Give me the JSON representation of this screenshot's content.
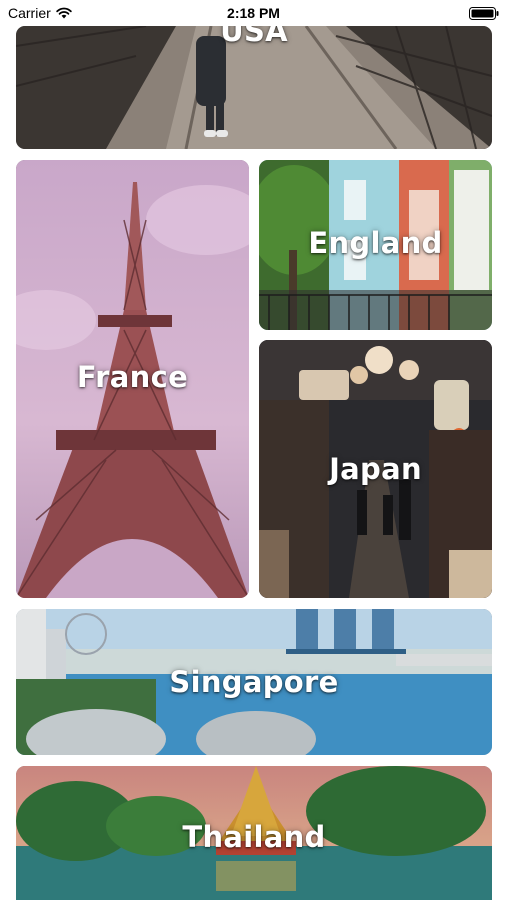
{
  "status_bar": {
    "carrier": "Carrier",
    "time": "2:18 PM"
  },
  "destinations": [
    {
      "name": "USA"
    },
    {
      "name": "France"
    },
    {
      "name": "England"
    },
    {
      "name": "Japan"
    },
    {
      "name": "Singapore"
    },
    {
      "name": "Thailand"
    }
  ],
  "icons": {
    "wifi": "wifi-icon",
    "battery": "battery-icon"
  }
}
